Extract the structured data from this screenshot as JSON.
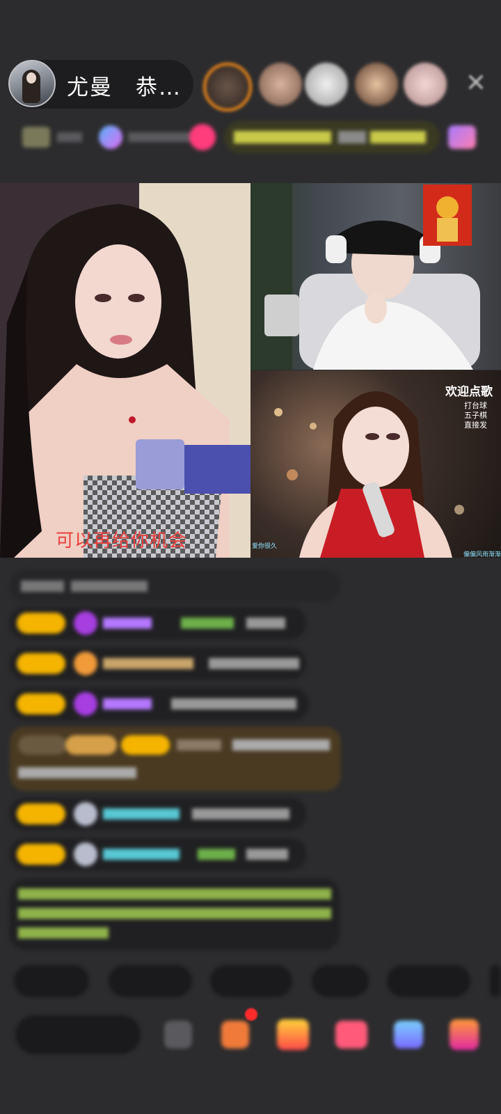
{
  "header": {
    "host_name": "尤曼　恭…",
    "close_icon": "close-icon"
  },
  "stream": {
    "lyric_text": "可以再给你机会",
    "welcome_title": "欢迎点歌",
    "request_items": [
      "打台球",
      "五子棋",
      "直接发"
    ],
    "left_tag": "爱你很久",
    "right_tag": "偏偏风雨渐渐把距离吹得好远"
  },
  "colors": {
    "background": "#2c2c2e",
    "lyric": "#e8403c",
    "level_badge": "#f4b400",
    "purple_name": "#b478ff",
    "teal_name": "#57c7d4",
    "green_text": "#9ec64b"
  }
}
